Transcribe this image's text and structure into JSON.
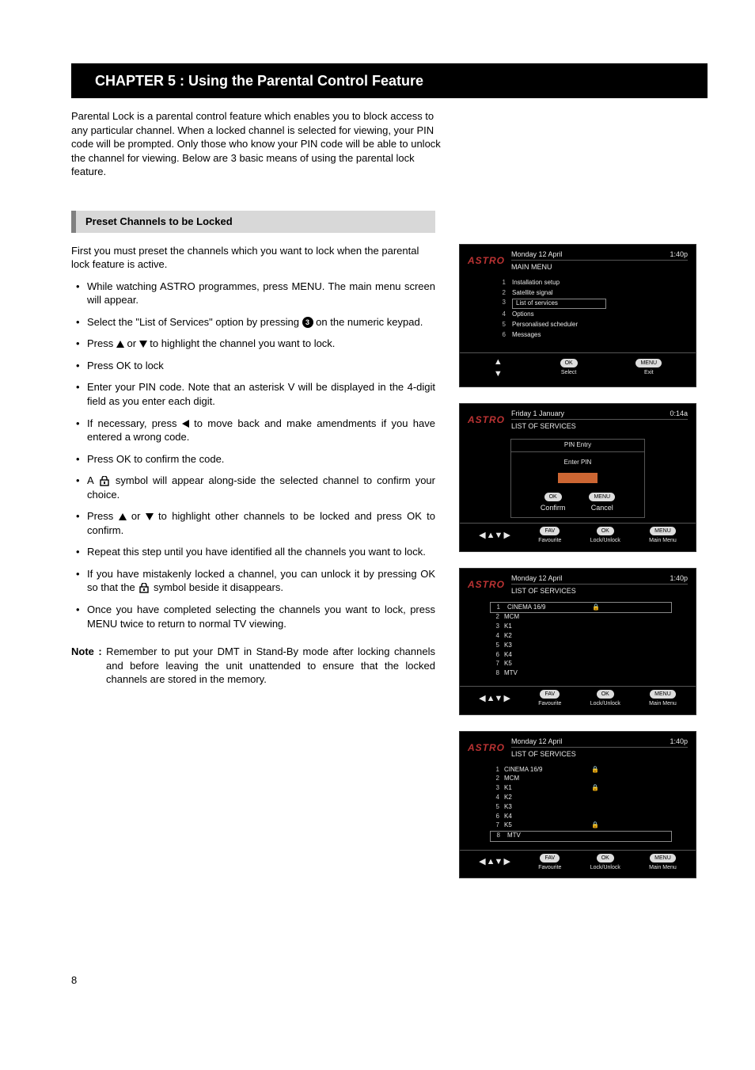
{
  "chapter_title": "CHAPTER 5 : Using the Parental Control Feature",
  "intro": "Parental Lock is a parental control feature which enables you to block access to any particular channel.  When a locked channel is selected for viewing, your PIN code will be prompted.  Only those who know your PIN code will be able to unlock the channel for viewing.  Below are 3 basic means of using the parental lock feature.",
  "section_heading": "Preset Channels to be Locked",
  "lead": "First you must preset the channels which you want to lock when the parental lock feature is active.",
  "keypad_number": "3",
  "bullets": {
    "b1a": "While watching ASTRO programmes, press MENU. The main menu screen will appear.",
    "b2a": "Select the \"List of Services\" option by pressing ",
    "b2b": " on the numeric keypad.",
    "b3a": "Press  ",
    "b3b": "  or  ",
    "b3c": "  to highlight the channel you want to lock.",
    "b4": "Press OK to lock",
    "b5": "Enter your PIN code.  Note that an asterisk V will be displayed in the 4-digit field as you enter each digit.",
    "b6a": "If necessary, press ",
    "b6b": " to move back and make amendments if you have entered a wrong code.",
    "b7": "Press OK to confirm the code.",
    "b8a": "A  ",
    "b8b": "  symbol will appear along-side the selected channel to confirm your choice.",
    "b9a": "Press  ",
    "b9b": " or ",
    "b9c": " to highlight other channels to be locked and press OK to confirm.",
    "b10": "Repeat this step until you have identified all the channels you want to lock.",
    "b11a": "If you have mistakenly locked a channel, you can unlock it by pressing OK so that the  ",
    "b11b": "  symbol beside it disappears.",
    "b12": "Once you have completed selecting the channels you want to lock, press MENU twice to return to normal TV viewing."
  },
  "note_label": "Note :",
  "note_text": " Remember to put your DMT in Stand-By mode after locking channels and before leaving the unit unattended to ensure that the locked channels are stored in the memory.",
  "page_number": "8",
  "tv_common": {
    "brand": "ASTRO",
    "fav_btn": "FAV",
    "ok_btn": "OK",
    "menu_btn": "MENU",
    "favourite": "Favourite",
    "lock_unlock": "Lock/Unlock",
    "main_menu": "Main Menu",
    "select": "Select",
    "exit": "Exit",
    "confirm": "Confirm",
    "cancel": "Cancel"
  },
  "tv1": {
    "date": "Monday 12 April",
    "time": "1:40p",
    "title": "MAIN MENU",
    "items": [
      {
        "n": "1",
        "label": "Installation setup"
      },
      {
        "n": "2",
        "label": "Satellite signal"
      },
      {
        "n": "3",
        "label": "List of services"
      },
      {
        "n": "4",
        "label": "Options"
      },
      {
        "n": "5",
        "label": "Personalised scheduler"
      },
      {
        "n": "6",
        "label": "Messages"
      }
    ],
    "selected_index": 2
  },
  "tv2": {
    "date": "Friday 1 January",
    "time": "0:14a",
    "title": "LIST OF SERVICES",
    "pin_entry": "PIN Entry",
    "enter_pin": "Enter PIN",
    "pin_mask": "* * * *"
  },
  "tv3": {
    "date": "Monday 12 April",
    "time": "1:40p",
    "title": "LIST OF SERVICES",
    "rows": [
      {
        "n": "1",
        "name": "CINEMA 16/9",
        "locked": true,
        "selected": true
      },
      {
        "n": "2",
        "name": "MCM",
        "locked": false
      },
      {
        "n": "3",
        "name": "K1",
        "locked": false
      },
      {
        "n": "4",
        "name": "K2",
        "locked": false
      },
      {
        "n": "5",
        "name": "K3",
        "locked": false
      },
      {
        "n": "6",
        "name": "K4",
        "locked": false
      },
      {
        "n": "7",
        "name": "K5",
        "locked": false
      },
      {
        "n": "8",
        "name": "MTV",
        "locked": false
      }
    ]
  },
  "tv4": {
    "date": "Monday 12 April",
    "time": "1:40p",
    "title": "LIST OF SERVICES",
    "rows": [
      {
        "n": "1",
        "name": "CINEMA 16/9",
        "locked": true
      },
      {
        "n": "2",
        "name": "MCM",
        "locked": false
      },
      {
        "n": "3",
        "name": "K1",
        "locked": true
      },
      {
        "n": "4",
        "name": "K2",
        "locked": false
      },
      {
        "n": "5",
        "name": "K3",
        "locked": false
      },
      {
        "n": "6",
        "name": "K4",
        "locked": false
      },
      {
        "n": "7",
        "name": "K5",
        "locked": true
      },
      {
        "n": "8",
        "name": "MTV",
        "locked": false,
        "selected": true
      }
    ]
  }
}
